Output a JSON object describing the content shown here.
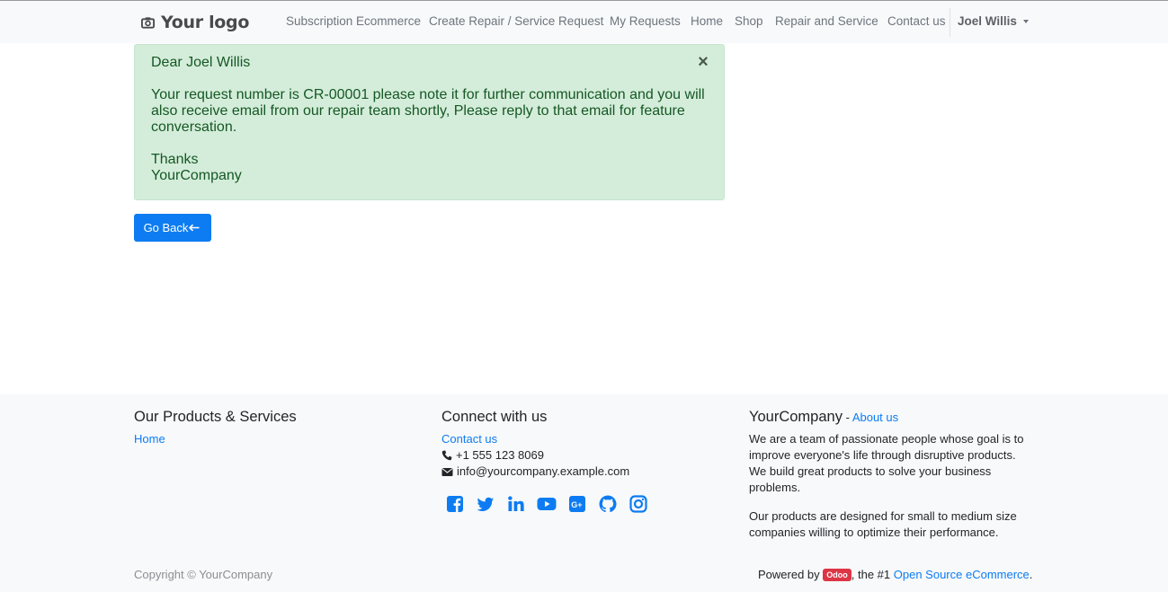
{
  "header": {
    "logo_text": "Your logo",
    "nav": [
      {
        "label": "Subscription Ecommerce"
      },
      {
        "label": "Create Repair / Service Request"
      },
      {
        "label": "My Requests"
      },
      {
        "label": "Home"
      },
      {
        "label": "Shop"
      },
      {
        "label": "Repair and Service"
      },
      {
        "label": "Contact us"
      }
    ],
    "user_name": "Joel Willis"
  },
  "alert": {
    "greeting": "Dear Joel Willis",
    "close_symbol": "×",
    "message": "Your request number is CR-00001 please note it for further communication and you will also receive email from our repair team shortly, Please reply to that email for feature conversation.",
    "thanks": "Thanks",
    "company": "YourCompany",
    "bg_color": "#d4edda",
    "text_color": "#155724"
  },
  "go_back_label": "Go Back",
  "footer": {
    "products": {
      "title": "Our Products & Services",
      "links": [
        {
          "label": "Home"
        }
      ]
    },
    "connect": {
      "title": "Connect with us",
      "contact_link": "Contact us",
      "phone": "+1 555 123 8069",
      "email": "info@yourcompany.example.com",
      "social_icons": [
        "facebook-icon",
        "twitter-icon",
        "linkedin-icon",
        "youtube-icon",
        "google-plus-icon",
        "github-icon",
        "instagram-icon"
      ]
    },
    "about": {
      "title": "YourCompany",
      "title_sep": " - ",
      "about_link": "About us",
      "paragraph1": "We are a team of passionate people whose goal is to improve everyone's life through disruptive products. We build great products to solve your business problems.",
      "paragraph2": "Our products are designed for small to medium size companies willing to optimize their performance."
    },
    "copyright": "Copyright © YourCompany",
    "powered_prefix": "Powered by ",
    "powered_badge": "Odoo",
    "powered_middle": ", the #1 ",
    "powered_link": "Open Source eCommerce",
    "powered_suffix": "."
  },
  "colors": {
    "primary": "#0d7cf2",
    "navbar_bg": "#f8f9fa",
    "footer_bg": "#f8f9fa",
    "badge_red": "#dc3545"
  }
}
